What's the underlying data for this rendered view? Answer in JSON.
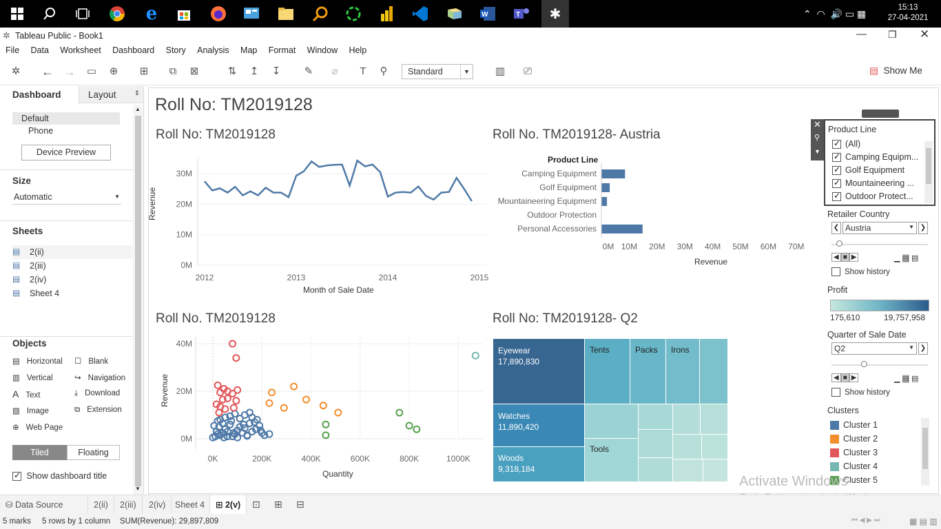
{
  "taskbar": {
    "time": "15:13",
    "date": "27-04-2021"
  },
  "window": {
    "title": "Tableau Public - Book1"
  },
  "menu": [
    "File",
    "Data",
    "Worksheet",
    "Dashboard",
    "Story",
    "Analysis",
    "Map",
    "Format",
    "Window",
    "Help"
  ],
  "toolbar": {
    "fit_select": "Standard",
    "show_me": "Show Me"
  },
  "left": {
    "tab_dashboard": "Dashboard",
    "tab_layout": "Layout",
    "device_default": "Default",
    "device_phone": "Phone",
    "device_preview": "Device Preview",
    "size_header": "Size",
    "size_value": "Automatic",
    "sheets_header": "Sheets",
    "sheets": [
      "2(ii)",
      "2(iii)",
      "2(iv)",
      "Sheet 4"
    ],
    "objects_header": "Objects",
    "objects": [
      "Horizontal",
      "Blank",
      "Vertical",
      "Navigation",
      "Text",
      "Download",
      "Image",
      "Extension",
      "Web Page"
    ],
    "tiled": "Tiled",
    "floating": "Floating",
    "show_title": "Show dashboard title"
  },
  "dashboard": {
    "title": "Roll No: TM2019128"
  },
  "line_chart": {
    "title": "Roll No: TM2019128",
    "ylabel": "Revenue",
    "xlabel": "Month of Sale Date",
    "yticks": [
      "30M",
      "20M",
      "10M",
      "0M"
    ],
    "xticks": [
      "2012",
      "2013",
      "2014",
      "2015"
    ]
  },
  "bar_chart": {
    "title": "Roll No. TM2019128- Austria",
    "header": "Product Line",
    "xlabel": "Revenue",
    "xticks": [
      "0M",
      "10M",
      "20M",
      "30M",
      "40M",
      "50M",
      "60M",
      "70M"
    ]
  },
  "scatter_chart": {
    "title": "Roll No. TM2019128",
    "ylabel": "Revenue",
    "xlabel": "Quantity",
    "yticks": [
      "40M",
      "20M",
      "0M"
    ],
    "xticks": [
      "0K",
      "200K",
      "400K",
      "600K",
      "800K",
      "1000K"
    ]
  },
  "treemap": {
    "title": "Roll No: TM2019128- Q2",
    "labels": [
      {
        "name": "Eyewear",
        "value": "17,890,830"
      },
      {
        "name": "Watches",
        "value": "11,890,420"
      },
      {
        "name": "Woods",
        "value": "9,318,184"
      },
      {
        "name": "Tents",
        "value": ""
      },
      {
        "name": "Packs",
        "value": ""
      },
      {
        "name": "Irons",
        "value": ""
      },
      {
        "name": "Tools",
        "value": ""
      }
    ]
  },
  "chart_data": [
    {
      "type": "line",
      "title": "Roll No: TM2019128",
      "xlabel": "Month of Sale Date",
      "ylabel": "Revenue",
      "ylim": [
        0,
        35000000
      ],
      "x_range": [
        "2012-01",
        "2015-01"
      ],
      "points": [
        {
          "x": "2012-01",
          "y": 27500000
        },
        {
          "x": "2012-02",
          "y": 24500000
        },
        {
          "x": "2012-03",
          "y": 25200000
        },
        {
          "x": "2012-04",
          "y": 23800000
        },
        {
          "x": "2012-05",
          "y": 25700000
        },
        {
          "x": "2012-06",
          "y": 22900000
        },
        {
          "x": "2012-07",
          "y": 24200000
        },
        {
          "x": "2012-08",
          "y": 22900000
        },
        {
          "x": "2012-09",
          "y": 25400000
        },
        {
          "x": "2012-10",
          "y": 23800000
        },
        {
          "x": "2012-11",
          "y": 23800000
        },
        {
          "x": "2012-12",
          "y": 22300000
        },
        {
          "x": "2013-01",
          "y": 29300000
        },
        {
          "x": "2013-02",
          "y": 30800000
        },
        {
          "x": "2013-03",
          "y": 34000000
        },
        {
          "x": "2013-04",
          "y": 32200000
        },
        {
          "x": "2013-05",
          "y": 32700000
        },
        {
          "x": "2013-06",
          "y": 32900000
        },
        {
          "x": "2013-07",
          "y": 33000000
        },
        {
          "x": "2013-08",
          "y": 26100000
        },
        {
          "x": "2013-09",
          "y": 34300000
        },
        {
          "x": "2013-10",
          "y": 32400000
        },
        {
          "x": "2013-11",
          "y": 33000000
        },
        {
          "x": "2013-12",
          "y": 30500000
        },
        {
          "x": "2014-01",
          "y": 22500000
        },
        {
          "x": "2014-02",
          "y": 23800000
        },
        {
          "x": "2014-03",
          "y": 24000000
        },
        {
          "x": "2014-04",
          "y": 23800000
        },
        {
          "x": "2014-05",
          "y": 25800000
        },
        {
          "x": "2014-06",
          "y": 22700000
        },
        {
          "x": "2014-07",
          "y": 21500000
        },
        {
          "x": "2014-08",
          "y": 23800000
        },
        {
          "x": "2014-09",
          "y": 24000000
        },
        {
          "x": "2014-10",
          "y": 28600000
        },
        {
          "x": "2014-11",
          "y": 25000000
        },
        {
          "x": "2014-12",
          "y": 21000000
        }
      ]
    },
    {
      "type": "bar",
      "title": "Roll No. TM2019128- Austria",
      "categories": [
        "Camping Equipment",
        "Golf Equipment",
        "Mountaineering Equipment",
        "Outdoor Protection",
        "Personal Accessories"
      ],
      "values": [
        8500000,
        3000000,
        2000000,
        100000,
        14800000
      ],
      "xlabel": "Revenue",
      "xlim": [
        0,
        75000000
      ]
    },
    {
      "type": "scatter",
      "title": "Roll No. TM2019128",
      "xlabel": "Quantity",
      "ylabel": "Revenue",
      "xlim": [
        0,
        1100000
      ],
      "ylim": [
        0,
        40000000
      ],
      "series": [
        {
          "name": "Cluster 1",
          "color": "#4e79a7",
          "points": [
            [
              0,
              500000
            ],
            [
              10000,
              1000000
            ],
            [
              20000,
              2000000
            ],
            [
              30000,
              1500000
            ],
            [
              15000,
              3000000
            ],
            [
              40000,
              2500000
            ],
            [
              50000,
              4000000
            ],
            [
              60000,
              3000000
            ],
            [
              25000,
              5000000
            ],
            [
              70000,
              6000000
            ],
            [
              80000,
              1000000
            ],
            [
              90000,
              2000000
            ],
            [
              100000,
              3500000
            ],
            [
              110000,
              5000000
            ],
            [
              120000,
              2500000
            ],
            [
              130000,
              4500000
            ],
            [
              140000,
              1200000
            ],
            [
              150000,
              6500000
            ],
            [
              160000,
              3000000
            ],
            [
              170000,
              7000000
            ],
            [
              180000,
              8000000
            ],
            [
              190000,
              5500000
            ],
            [
              200000,
              2500000
            ],
            [
              210000,
              1500000
            ],
            [
              230000,
              2000000
            ],
            [
              30000,
              8000000
            ],
            [
              50000,
              9000000
            ],
            [
              70000,
              9500000
            ],
            [
              90000,
              10500000
            ],
            [
              110000,
              8500000
            ],
            [
              130000,
              10000000
            ],
            [
              150000,
              11000000
            ],
            [
              160000,
              9000000
            ],
            [
              40000,
              6500000
            ],
            [
              20000,
              7500000
            ],
            [
              5000,
              5500000
            ],
            [
              60000,
              1000000
            ],
            [
              100000,
              500000
            ],
            [
              140000,
              1500000
            ],
            [
              175000,
              4000000
            ],
            [
              195000,
              3500000
            ],
            [
              75000,
              7500000
            ],
            [
              45000,
              500000
            ],
            [
              85000,
              2500000
            ],
            [
              125000,
              6000000
            ]
          ]
        },
        {
          "name": "Cluster 2",
          "color": "#f28e2b",
          "points": [
            [
              230000,
              15000000
            ],
            [
              290000,
              13000000
            ],
            [
              330000,
              22000000
            ],
            [
              380000,
              16500000
            ],
            [
              450000,
              14000000
            ],
            [
              510000,
              11000000
            ],
            [
              240000,
              19500000
            ]
          ]
        },
        {
          "name": "Cluster 3",
          "color": "#e15759",
          "points": [
            [
              80000,
              40000000
            ],
            [
              95000,
              34000000
            ],
            [
              20000,
              22500000
            ],
            [
              45000,
              21000000
            ],
            [
              60000,
              20000000
            ],
            [
              30000,
              19500000
            ],
            [
              80000,
              19000000
            ],
            [
              100000,
              20500000
            ],
            [
              40000,
              16500000
            ],
            [
              60000,
              17000000
            ],
            [
              95000,
              16000000
            ],
            [
              15000,
              14500000
            ],
            [
              30000,
              13500000
            ],
            [
              50000,
              12500000
            ],
            [
              85000,
              13000000
            ],
            [
              25000,
              11000000
            ]
          ]
        },
        {
          "name": "Cluster 4",
          "color": "#76b7b2",
          "points": [
            [
              1070000,
              35000000
            ]
          ]
        },
        {
          "name": "Cluster 5",
          "color": "#59a14f",
          "points": [
            [
              760000,
              11000000
            ],
            [
              800000,
              5500000
            ],
            [
              830000,
              4000000
            ],
            [
              460000,
              6000000
            ],
            [
              460000,
              1500000
            ]
          ]
        }
      ]
    },
    {
      "type": "treemap",
      "title": "Roll No: TM2019128- Q2",
      "items": [
        {
          "name": "Eyewear",
          "value": 17890830
        },
        {
          "name": "Watches",
          "value": 11890420
        },
        {
          "name": "Woods",
          "value": 9318184
        },
        {
          "name": "Tents",
          "value": null
        },
        {
          "name": "Packs",
          "value": null
        },
        {
          "name": "Irons",
          "value": null
        },
        {
          "name": "Tools",
          "value": null
        }
      ]
    }
  ],
  "filters": {
    "product_line_header": "Product Line",
    "product_line_items": [
      "(All)",
      "Camping Equipm...",
      "Golf Equipment",
      "Mountaineering ...",
      "Outdoor Protect..."
    ],
    "country_header": "Retailer Country",
    "country_value": "Austria",
    "show_history": "Show history",
    "profit_header": "Profit",
    "profit_min": "175,610",
    "profit_max": "19,757,958",
    "quarter_header": "Quarter of Sale Date",
    "quarter_value": "Q2",
    "show_history2": "Show history",
    "clusters_header": "Clusters",
    "clusters": [
      {
        "name": "Cluster 1",
        "color": "#4e79a7"
      },
      {
        "name": "Cluster 2",
        "color": "#f28e2b"
      },
      {
        "name": "Cluster 3",
        "color": "#e15759"
      },
      {
        "name": "Cluster 4",
        "color": "#76b7b2"
      },
      {
        "name": "Cluster 5",
        "color": "#59a14f"
      }
    ]
  },
  "watermark": {
    "line1": "Activate Windows",
    "line2": "Go to Settings to activate Windows."
  },
  "bottom_tabs": [
    "Data Source",
    "2(ii)",
    "2(iii)",
    "2(iv)",
    "Sheet 4",
    "2(v)"
  ],
  "status": {
    "marks": "5 marks",
    "rows": "5 rows by 1 column",
    "sum": "SUM(Revenue): 29,897,809"
  }
}
